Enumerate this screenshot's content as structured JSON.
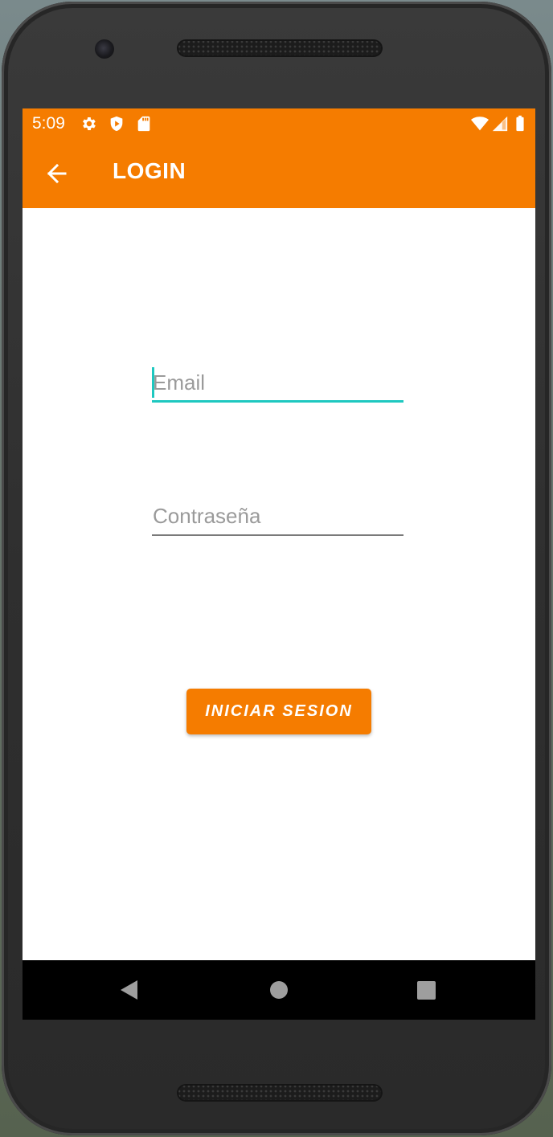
{
  "status_bar": {
    "time": "5:09",
    "left_icons": [
      "gear-icon",
      "shield-play-icon",
      "sd-card-icon"
    ],
    "right_icons": [
      "wifi-icon",
      "signal-icon",
      "battery-icon"
    ]
  },
  "app_bar": {
    "back_icon": "arrow-left-icon",
    "title": "LOGIN"
  },
  "form": {
    "email_placeholder": "Email",
    "email_value": "",
    "password_placeholder": "Contraseña",
    "password_value": "",
    "submit_label": "INICIAR SESION"
  },
  "nav_bar": {
    "buttons": [
      "back-triangle-icon",
      "home-circle-icon",
      "recents-square-icon"
    ]
  },
  "colors": {
    "primary": "#f57c00",
    "accent": "#1ec8c0"
  }
}
